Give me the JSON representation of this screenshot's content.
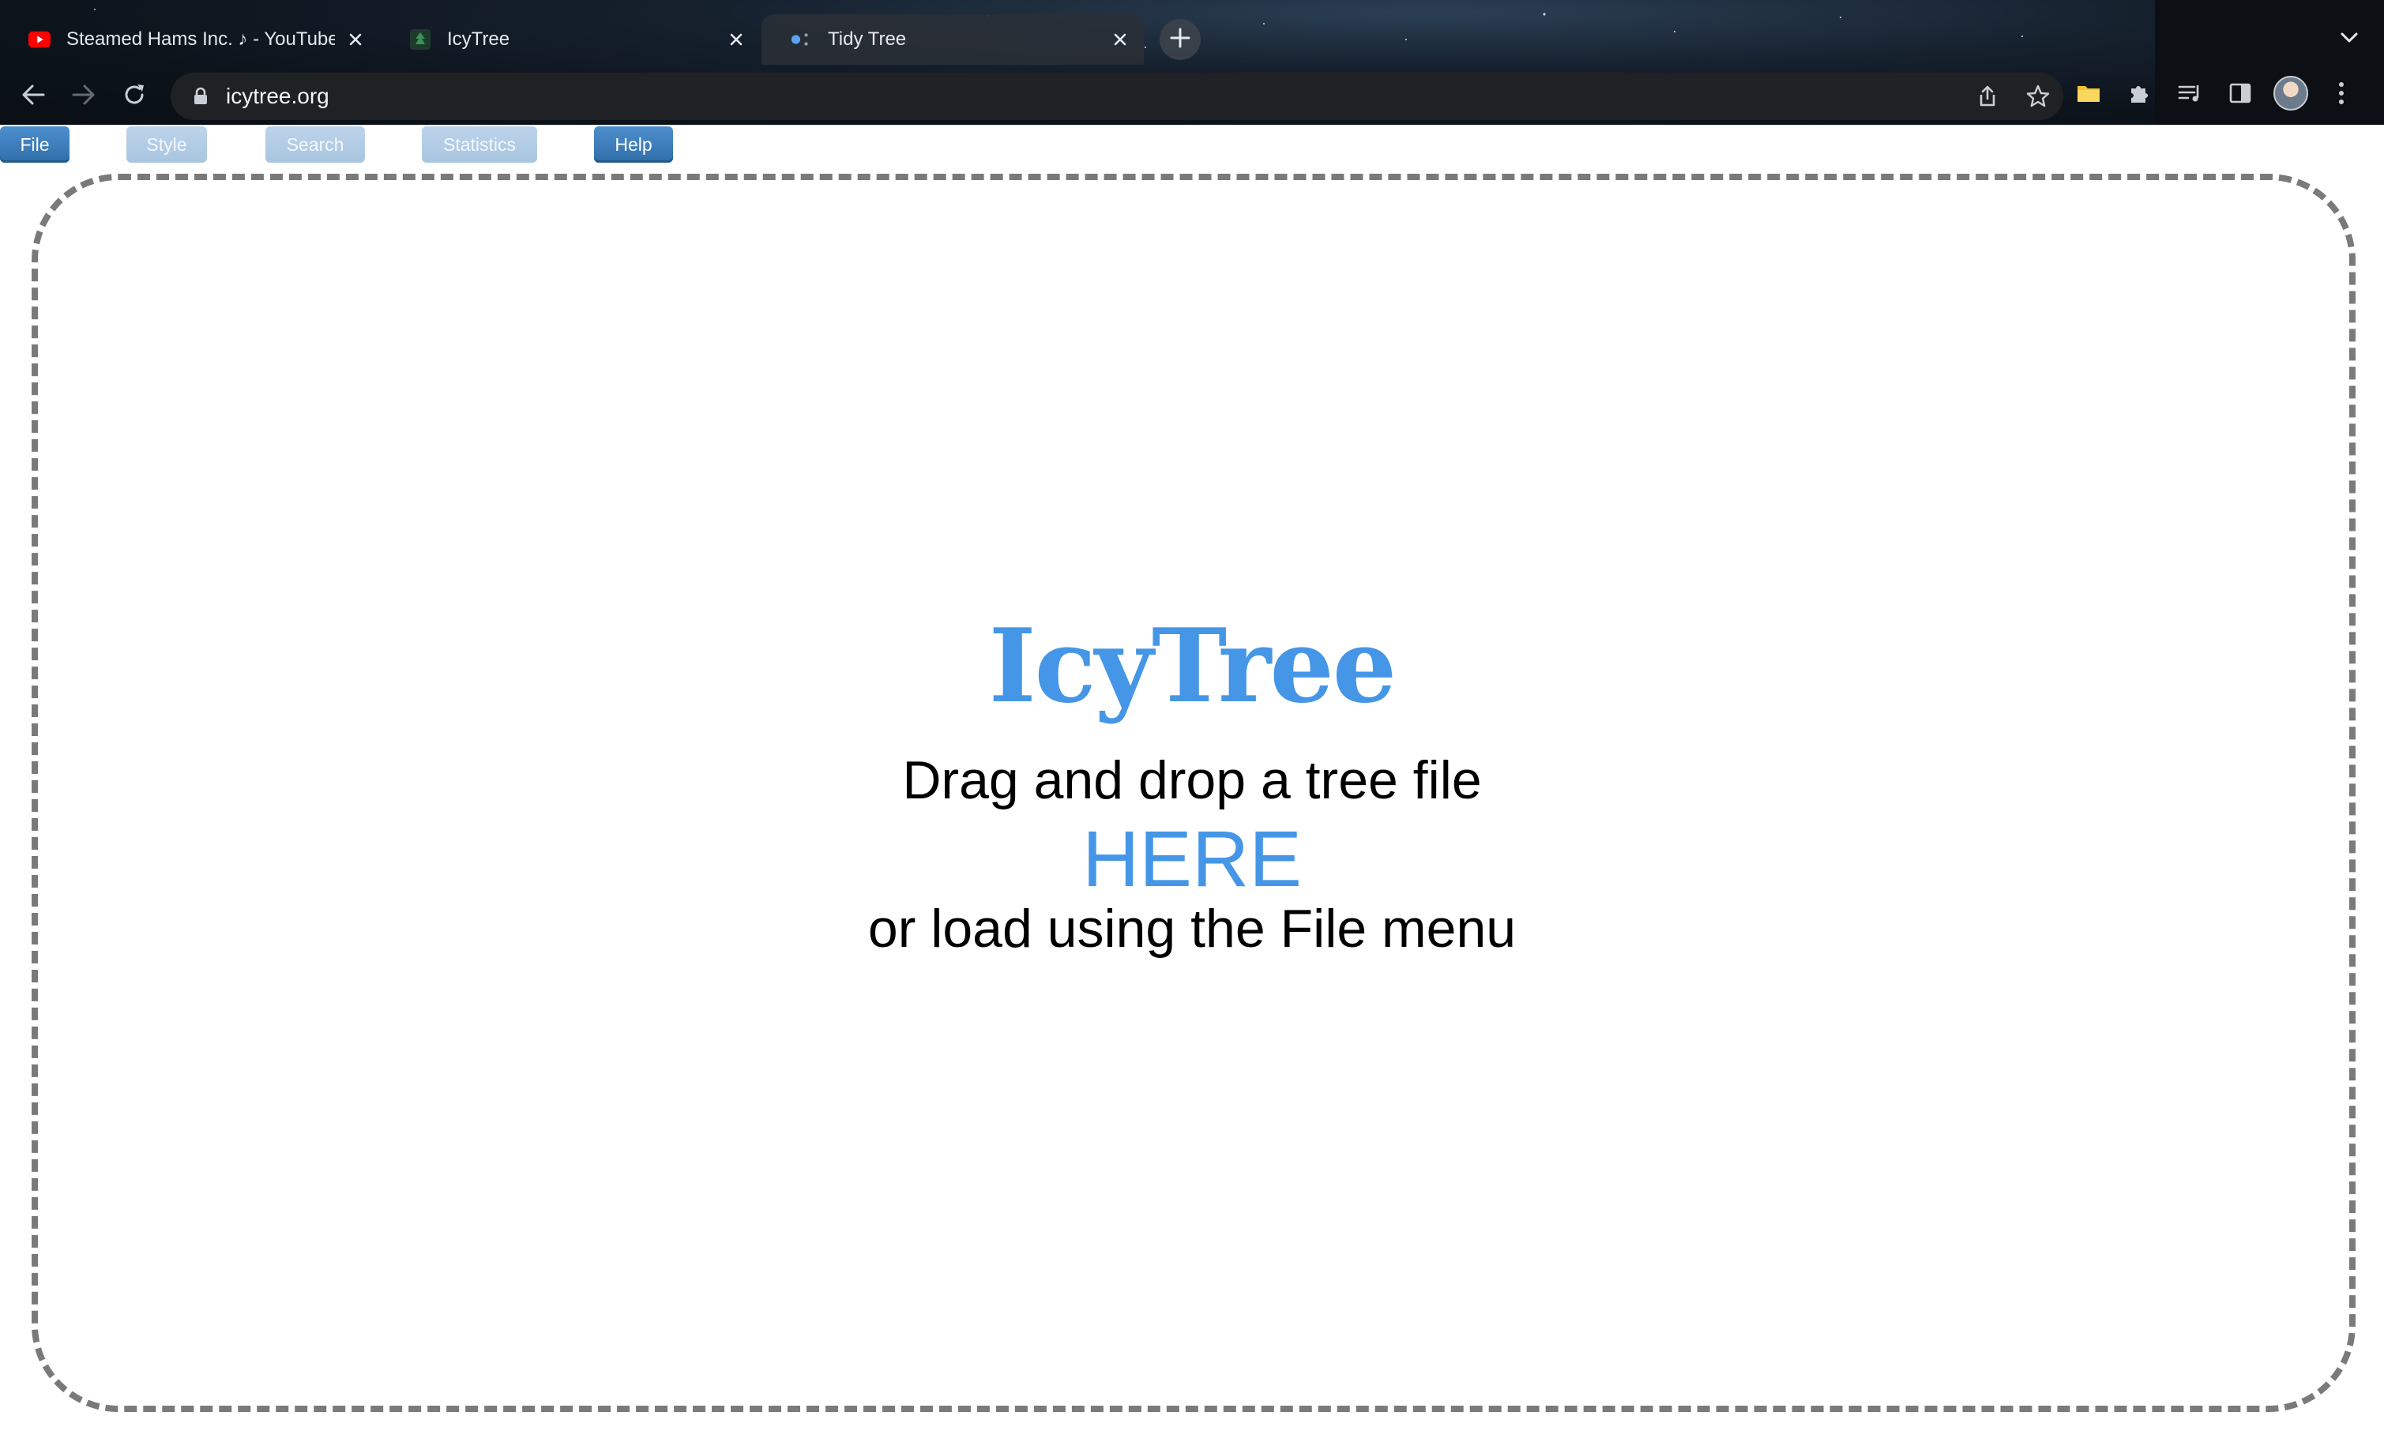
{
  "browser": {
    "tabs": [
      {
        "title": "Steamed Hams Inc. ♪ - YouTube",
        "favicon": "youtube-icon",
        "active": false
      },
      {
        "title": "IcyTree",
        "favicon": "icytree-favicon-icon",
        "active": false
      },
      {
        "title": "Tidy Tree",
        "favicon": "observable-dots-icon",
        "active": true
      }
    ],
    "url": "icytree.org"
  },
  "menu": {
    "items": [
      {
        "label": "File",
        "enabled": true
      },
      {
        "label": "Style",
        "enabled": false
      },
      {
        "label": "Search",
        "enabled": false
      },
      {
        "label": "Statistics",
        "enabled": false
      },
      {
        "label": "Help",
        "enabled": true
      }
    ]
  },
  "dropzone": {
    "title": "IcyTree",
    "line1": "Drag and drop a tree file",
    "link": "HERE",
    "line3": "or load using the File menu"
  },
  "colors": {
    "accent": "#4596e6",
    "menu_enabled": "#3d7ebd",
    "menu_disabled": "#b3cde6",
    "dropzone_border": "#7a7a7a"
  }
}
